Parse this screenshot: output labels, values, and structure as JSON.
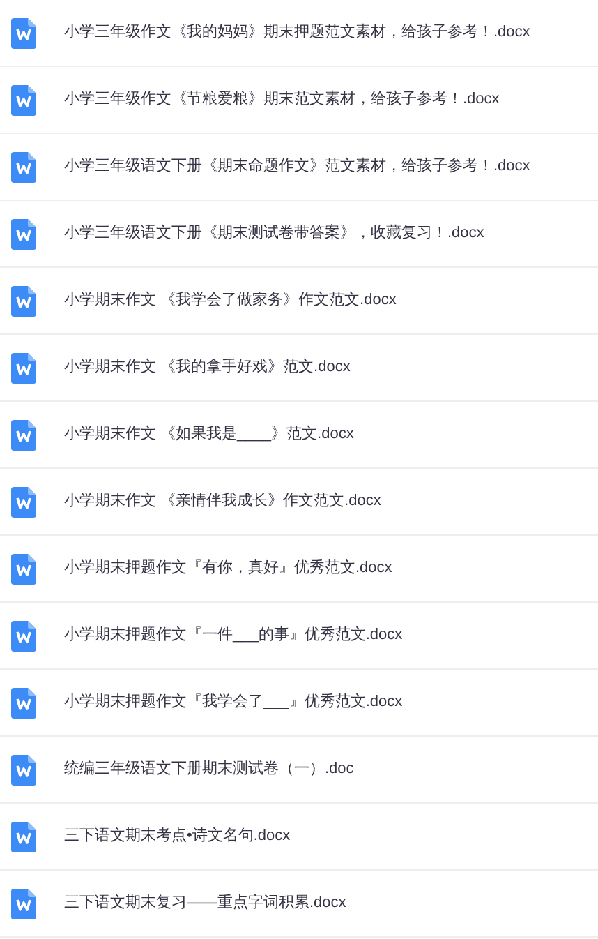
{
  "files": [
    {
      "name": "小学三年级作文《我的妈妈》期末押题范文素材，给孩子参考！.docx"
    },
    {
      "name": "小学三年级作文《节粮爱粮》期末范文素材，给孩子参考！.docx"
    },
    {
      "name": "小学三年级语文下册《期末命题作文》范文素材，给孩子参考！.docx"
    },
    {
      "name": "小学三年级语文下册《期末测试卷带答案》，收藏复习！.docx"
    },
    {
      "name": "小学期末作文 《我学会了做家务》作文范文.docx"
    },
    {
      "name": "小学期末作文 《我的拿手好戏》范文.docx"
    },
    {
      "name": "小学期末作文 《如果我是____》范文.docx"
    },
    {
      "name": "小学期末作文 《亲情伴我成长》作文范文.docx"
    },
    {
      "name": "小学期末押题作文『有你，真好』优秀范文.docx"
    },
    {
      "name": "小学期末押题作文『一件___的事』优秀范文.docx"
    },
    {
      "name": "小学期末押题作文『我学会了___』优秀范文.docx"
    },
    {
      "name": "统编三年级语文下册期末测试卷（一）.doc"
    },
    {
      "name": "三下语文期末考点•诗文名句.docx"
    },
    {
      "name": "三下语文期末复习——重点字词积累.docx"
    }
  ]
}
